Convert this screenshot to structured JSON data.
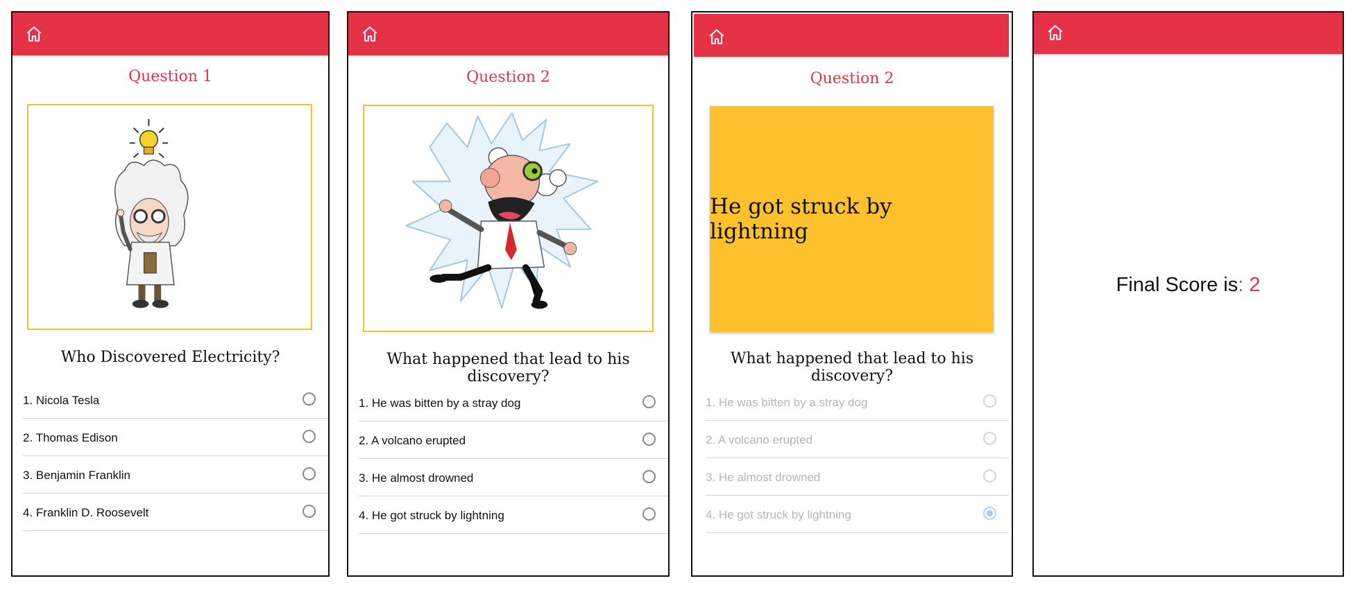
{
  "theme": {
    "accent": "#e63246",
    "card": "#fdc12e",
    "frame_border": "#f6c02a",
    "disabled_text": "#b5b5b5"
  },
  "icons": {
    "home": "home-icon",
    "radio": "radio-button"
  },
  "screens": [
    {
      "title": "Question 1",
      "question": "Who Discovered Electricity?",
      "image": "cartoon-scientist-lightbulb",
      "options": [
        {
          "label": "1. Nicola Tesla"
        },
        {
          "label": "2. Thomas Edison"
        },
        {
          "label": "3. Benjamin Franklin"
        },
        {
          "label": "4. Franklin D. Roosevelt"
        }
      ]
    },
    {
      "title": "Question 2",
      "question": "What happened that lead to his discovery?",
      "image": "cartoon-scientist-electrocuted",
      "options": [
        {
          "label": "1. He was bitten by a stray dog"
        },
        {
          "label": "2. A volcano erupted"
        },
        {
          "label": "3. He almost drowned"
        },
        {
          "label": "4. He got struck by lightning"
        }
      ]
    },
    {
      "title": "Question 2",
      "answer_card": "He got struck by lightning",
      "question": "What happened that lead to his discovery?",
      "options": [
        {
          "label": "1. He was bitten by a stray dog",
          "selected": false
        },
        {
          "label": "2. A volcano erupted",
          "selected": false
        },
        {
          "label": "3. He almost drowned",
          "selected": false
        },
        {
          "label": "4. He got struck by lightning",
          "selected": true
        }
      ]
    },
    {
      "final_label": "Final Score is",
      "final_sep": ": ",
      "final_score": "2"
    }
  ]
}
